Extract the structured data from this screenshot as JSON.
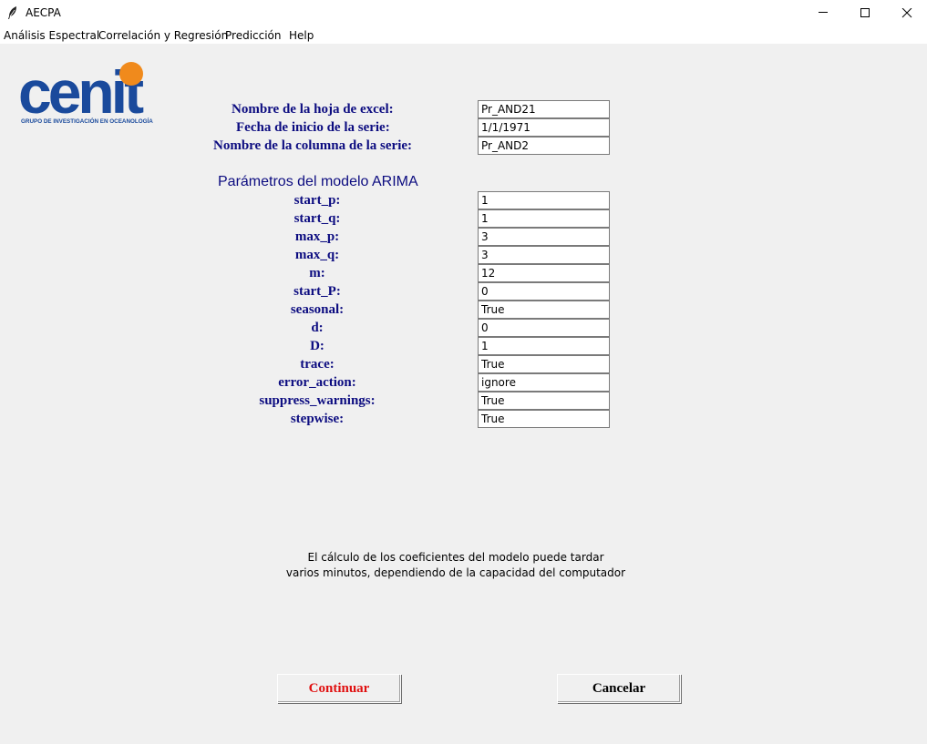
{
  "window": {
    "title": "AECPA",
    "app_icon": "feather-icon",
    "controls": [
      "minimize-icon",
      "maximize-icon",
      "close-icon"
    ]
  },
  "menu": {
    "items": [
      "Análisis Espectral",
      "Correlación y Regresión",
      "Predicción",
      "Help"
    ]
  },
  "logo": {
    "text": "cenit",
    "tagline": "GRUPO DE INVESTIGACIÓN EN OCEANOLOGÍA",
    "colors": {
      "letters": "#1a4a9c",
      "dot": "#f08a1c"
    }
  },
  "form": {
    "fields": [
      {
        "label": "Nombre de la hoja de excel:",
        "value": "Pr_AND21"
      },
      {
        "label": "Fecha de inicio de la serie:",
        "value": "1/1/1971"
      },
      {
        "label": "Nombre de la columna de la serie:",
        "value": "Pr_AND2"
      }
    ],
    "arima_title": "Parámetros del modelo ARIMA",
    "params": [
      {
        "label": "start_p:",
        "value": "1"
      },
      {
        "label": "start_q:",
        "value": "1"
      },
      {
        "label": "max_p:",
        "value": "3"
      },
      {
        "label": "max_q:",
        "value": "3"
      },
      {
        "label": "m:",
        "value": "12"
      },
      {
        "label": "start_P:",
        "value": "0"
      },
      {
        "label": "seasonal:",
        "value": "True"
      },
      {
        "label": "d:",
        "value": "0"
      },
      {
        "label": "D:",
        "value": "1"
      },
      {
        "label": "trace:",
        "value": "True"
      },
      {
        "label": "error_action:",
        "value": "ignore"
      },
      {
        "label": "suppress_warnings:",
        "value": "True"
      },
      {
        "label": "stepwise:",
        "value": "True"
      }
    ]
  },
  "note": {
    "line1": "El cálculo de los coeficientes del modelo puede tardar",
    "line2": "varios minutos, dependiendo de la capacidad del computador"
  },
  "buttons": {
    "continue_label": "Continuar",
    "cancel_label": "Cancelar"
  },
  "colors": {
    "label": "#0c0c80",
    "continue_text": "#e01010",
    "cancel_text": "#000000",
    "background": "#f0f0f0"
  }
}
